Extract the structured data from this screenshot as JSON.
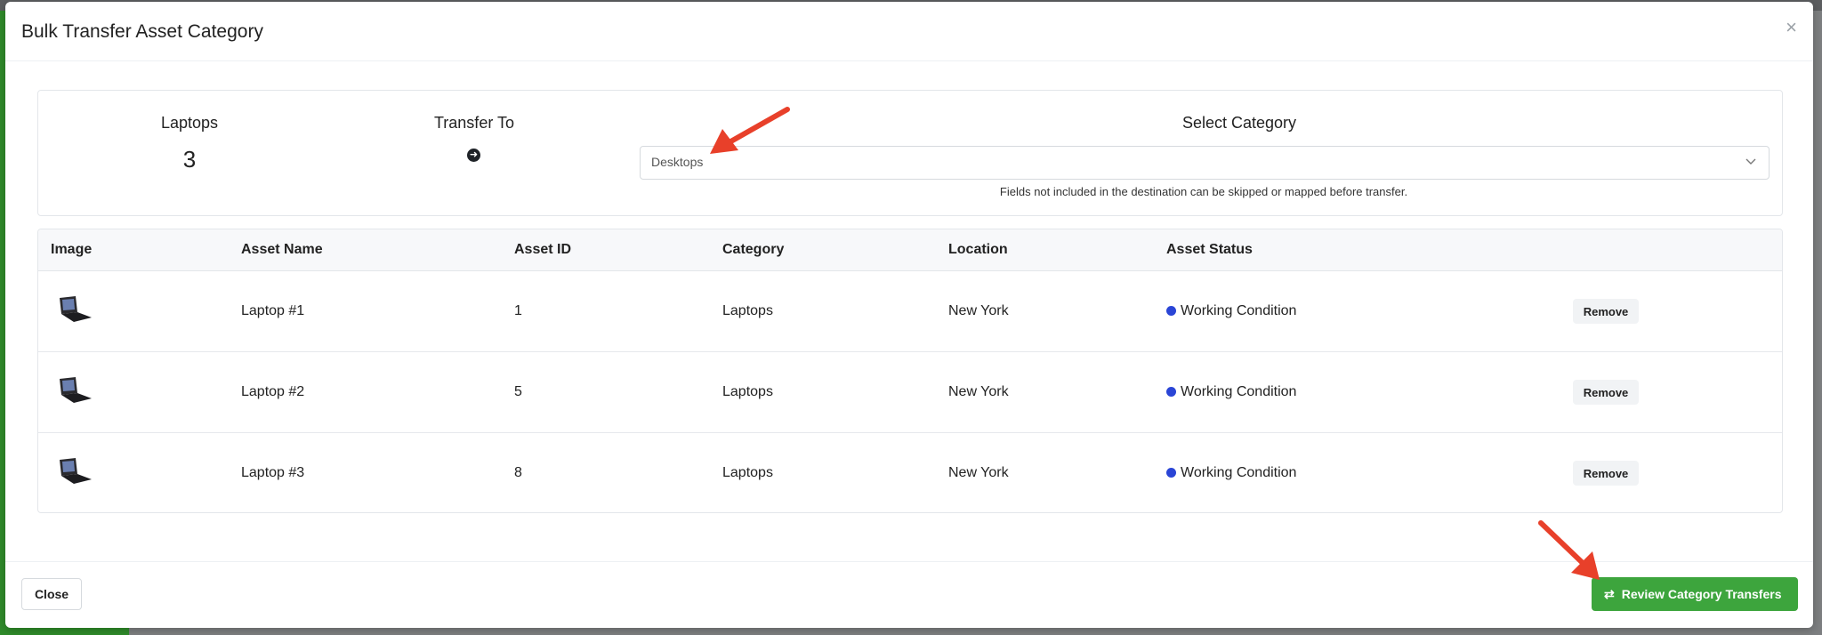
{
  "modal": {
    "title": "Bulk Transfer Asset Category",
    "close_symbol": "×"
  },
  "summary": {
    "source_label": "Laptops",
    "source_count": "3",
    "transfer_label": "Transfer To",
    "select_label": "Select Category",
    "selected_category": "Desktops",
    "help_text": "Fields not included in the destination can be skipped or mapped before transfer."
  },
  "table": {
    "headers": [
      "Image",
      "Asset Name",
      "Asset ID",
      "Category",
      "Location",
      "Asset Status"
    ],
    "rows": [
      {
        "name": "Laptop #1",
        "id": "1",
        "category": "Laptops",
        "location": "New York",
        "status": "Working Condition",
        "action": "Remove"
      },
      {
        "name": "Laptop #2",
        "id": "5",
        "category": "Laptops",
        "location": "New York",
        "status": "Working Condition",
        "action": "Remove"
      },
      {
        "name": "Laptop #3",
        "id": "8",
        "category": "Laptops",
        "location": "New York",
        "status": "Working Condition",
        "action": "Remove"
      }
    ]
  },
  "footer": {
    "close_label": "Close",
    "review_label": "Review Category Transfers"
  },
  "colors": {
    "primary_green": "#3da53d",
    "status_blue": "#2a45d6",
    "annotation_red": "#e8402a"
  },
  "icons": [
    "close-icon",
    "arrow-right-circle-icon",
    "chevron-down-icon",
    "laptop-thumbnail",
    "status-dot-icon",
    "swap-icon",
    "annotation-arrow"
  ]
}
